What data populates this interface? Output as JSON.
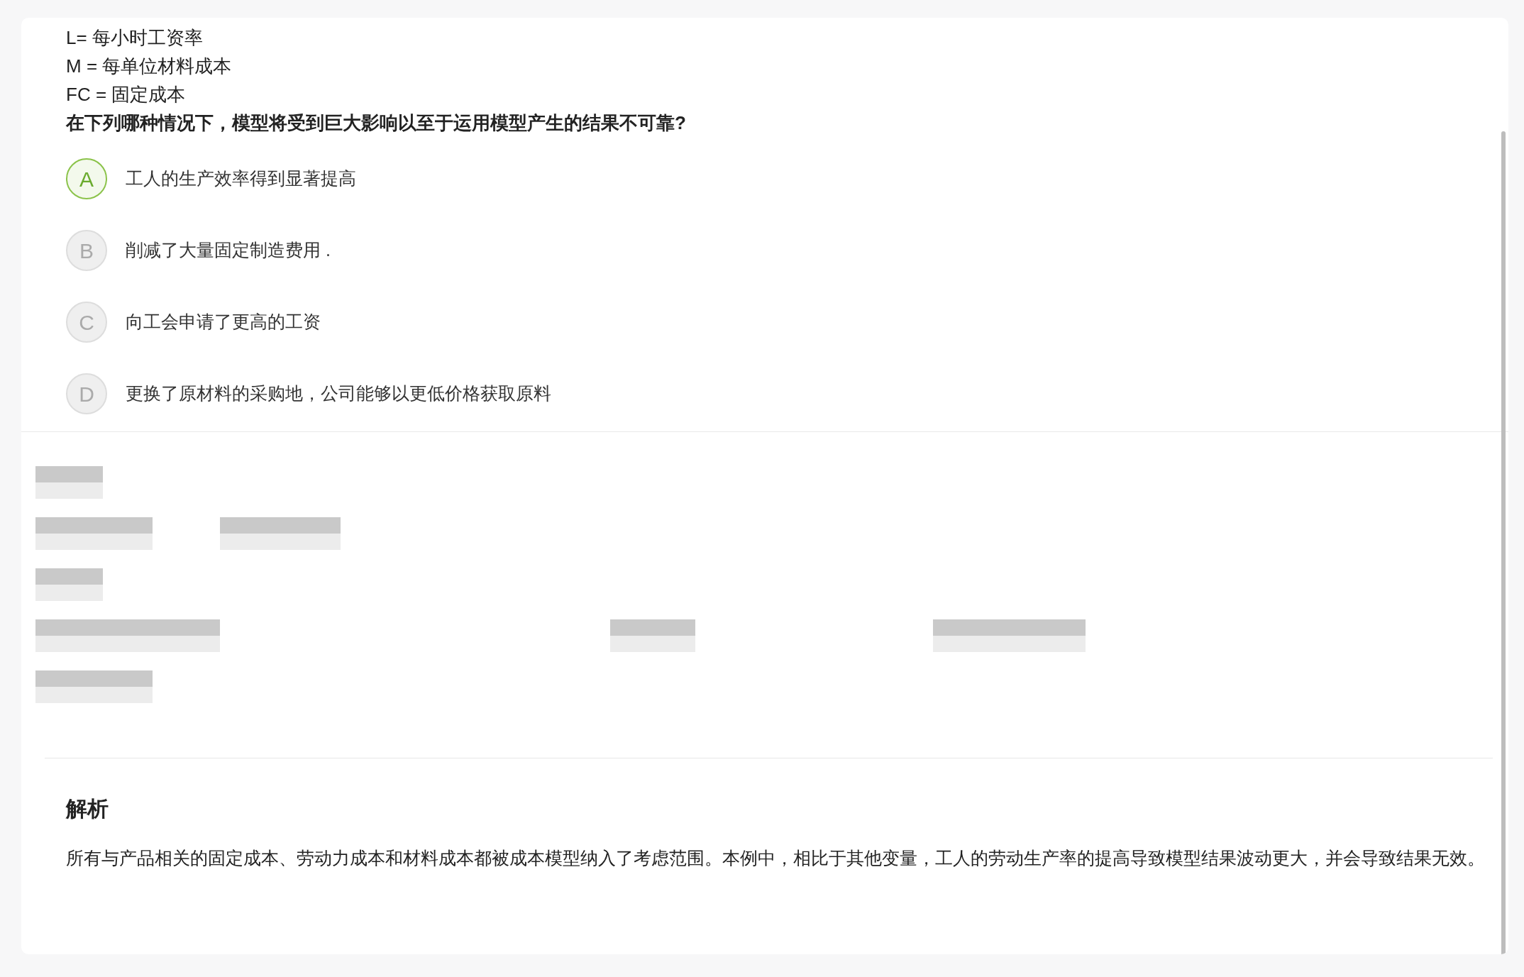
{
  "question": {
    "lines": [
      "L= 每小时工资率",
      "M = 每单位材料成本",
      "FC = 固定成本"
    ],
    "prompt": "在下列哪种情况下，模型将受到巨大影响以至于运用模型产生的结果不可靠?"
  },
  "options": [
    {
      "letter": "A",
      "text": "工人的生产效率得到显著提高",
      "selected": true
    },
    {
      "letter": "B",
      "text": "削减了大量固定制造费用 .",
      "selected": false
    },
    {
      "letter": "C",
      "text": "向工会申请了更高的工资",
      "selected": false
    },
    {
      "letter": "D",
      "text": "更换了原材料的采购地，公司能够以更低价格获取原料",
      "selected": false
    }
  ],
  "analysis": {
    "title": "解析",
    "text": "所有与产品相关的固定成本、劳动力成本和材料成本都被成本模型纳入了考虑范围。本例中，相比于其他变量，工人的劳动生产率的提高导致模型结果波动更大，并会导致结果无效。"
  }
}
